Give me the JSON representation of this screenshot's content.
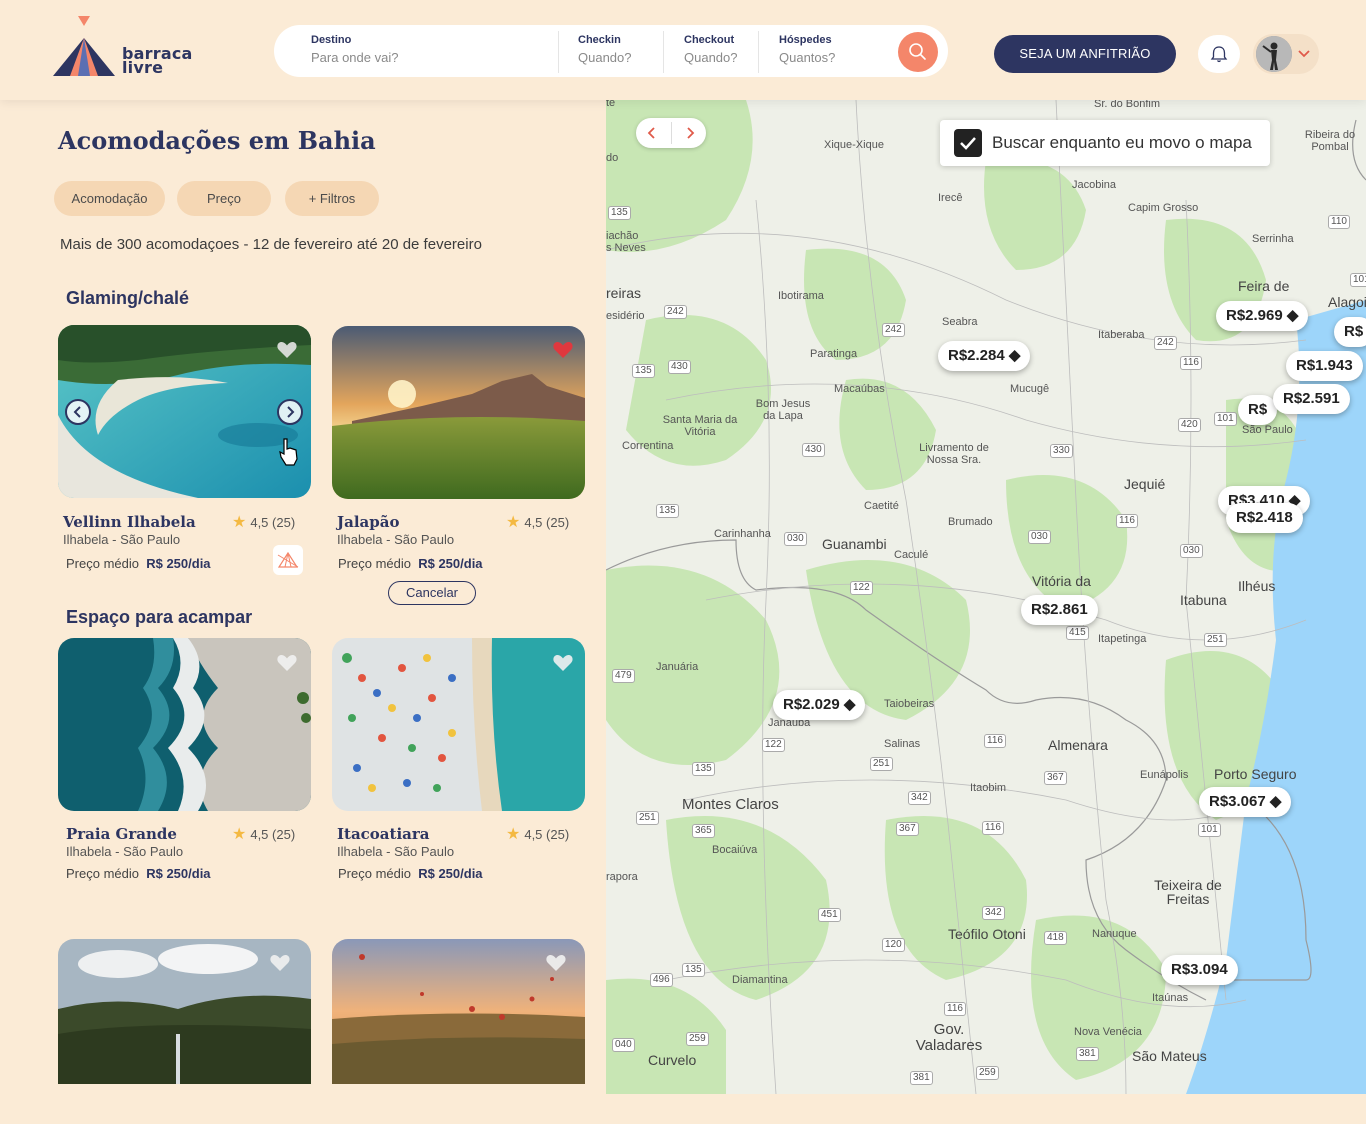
{
  "header": {
    "logo_text_line1": "barraca",
    "logo_text_line2": "livre",
    "search": {
      "destination_label": "Destino",
      "destination_placeholder": "Para onde vai?",
      "checkin_label": "Checkin",
      "checkin_placeholder": "Quando?",
      "checkout_label": "Checkout",
      "checkout_placeholder": "Quando?",
      "guests_label": "Hóspedes",
      "guests_placeholder": "Quantos?"
    },
    "host_button": "SEJA UM ANFITRIÃO"
  },
  "listing": {
    "title": "Acomodações em Bahia",
    "filters": [
      "Acomodação",
      "Preço",
      "+ Filtros"
    ],
    "summary": "Mais de 300 acomodaçoes - 12 de fevereiro até 20 de fevereiro",
    "sections": [
      {
        "title": "Glaming/chalé",
        "cards": [
          {
            "name": "Vellinn Ilhabela",
            "rating": "4,5 (25)",
            "location": "Ilhabela - São Paulo",
            "price_label": "Preço médio",
            "price": "R$ 250/dia",
            "favorited": false
          },
          {
            "name": "Jalapão",
            "rating": "4,5 (25)",
            "location": "Ilhabela - São Paulo",
            "price_label": "Preço médio",
            "price": "R$ 250/dia",
            "favorited": true,
            "cancel_label": "Cancelar"
          }
        ]
      },
      {
        "title": "Espaço para acampar",
        "cards": [
          {
            "name": "Praia Grande",
            "rating": "4,5 (25)",
            "location": "Ilhabela - São Paulo",
            "price_label": "Preço médio",
            "price": "R$ 250/dia",
            "favorited": false
          },
          {
            "name": "Itacoatiara",
            "rating": "4,5 (25)",
            "location": "Ilhabela - São Paulo",
            "price_label": "Preço médio",
            "price": "R$ 250/dia",
            "favorited": false
          }
        ]
      }
    ]
  },
  "map": {
    "toggle_label": "Buscar enquanto eu movo o mapa",
    "toggle_checked": true,
    "prices": [
      "R$2.969",
      "R$1.943",
      "R$2.591",
      "R$2.284",
      "R$2.418",
      "R$2.861",
      "R$2.029",
      "R$3.067",
      "R$3.094"
    ],
    "places": [
      "Sr. do Bonfim",
      "Xique-Xique",
      "Ribeira do Pombal",
      "Jacobina",
      "Irecê",
      "Capim Grosso",
      "Serrinha",
      "Feira de",
      "Alagoi",
      "Ibotirama",
      "Seabra",
      "Itaberaba",
      "Paratinga",
      "Macaúbas",
      "Mucugê",
      "Bom Jesus da Lapa",
      "Santa Maria da Vitória",
      "Correntina",
      "Livramento de Nossa Sra.",
      "São Paulo",
      "Jequié",
      "Caetité",
      "Brumado",
      "Carinhanha",
      "Guanambi",
      "Caculé",
      "Vitória da",
      "Itabuna",
      "Ilhéus",
      "Itapetinga",
      "Januária",
      "Janaúba",
      "Taiobeiras",
      "Salinas",
      "Almenara",
      "Eunápolis",
      "Porto Seguro",
      "Montes Claros",
      "Itaobim",
      "Bocaiúva",
      "Teixeira de Freitas",
      "Teófilo Otoni",
      "Nanuque",
      "Diamantina",
      "Gov. Valadares",
      "Nova Venécia",
      "São Mateus",
      "Curvelo",
      "Itaúnas",
      "iachão",
      "s Neves",
      "reiras",
      "esidério",
      "rapora",
      "te",
      "do"
    ],
    "roads": [
      "135",
      "242",
      "430",
      "135",
      "242",
      "242",
      "116",
      "420",
      "101",
      "430",
      "330",
      "135",
      "116",
      "030",
      "030",
      "030",
      "122",
      "415",
      "251",
      "479",
      "122",
      "251",
      "116",
      "367",
      "135",
      "342",
      "251",
      "365",
      "367",
      "116",
      "101",
      "451",
      "342",
      "418",
      "120",
      "135",
      "496",
      "259",
      "116",
      "381",
      "040",
      "381",
      "259",
      "110",
      "101"
    ]
  },
  "colors": {
    "background": "#fbebd6",
    "brand_navy": "#2d3561",
    "accent_coral": "#f4866a",
    "chip": "#f5d7b4",
    "heart_active": "#e0383e",
    "map_green": "#c8e6b4",
    "sea": "#9dd5fa"
  }
}
